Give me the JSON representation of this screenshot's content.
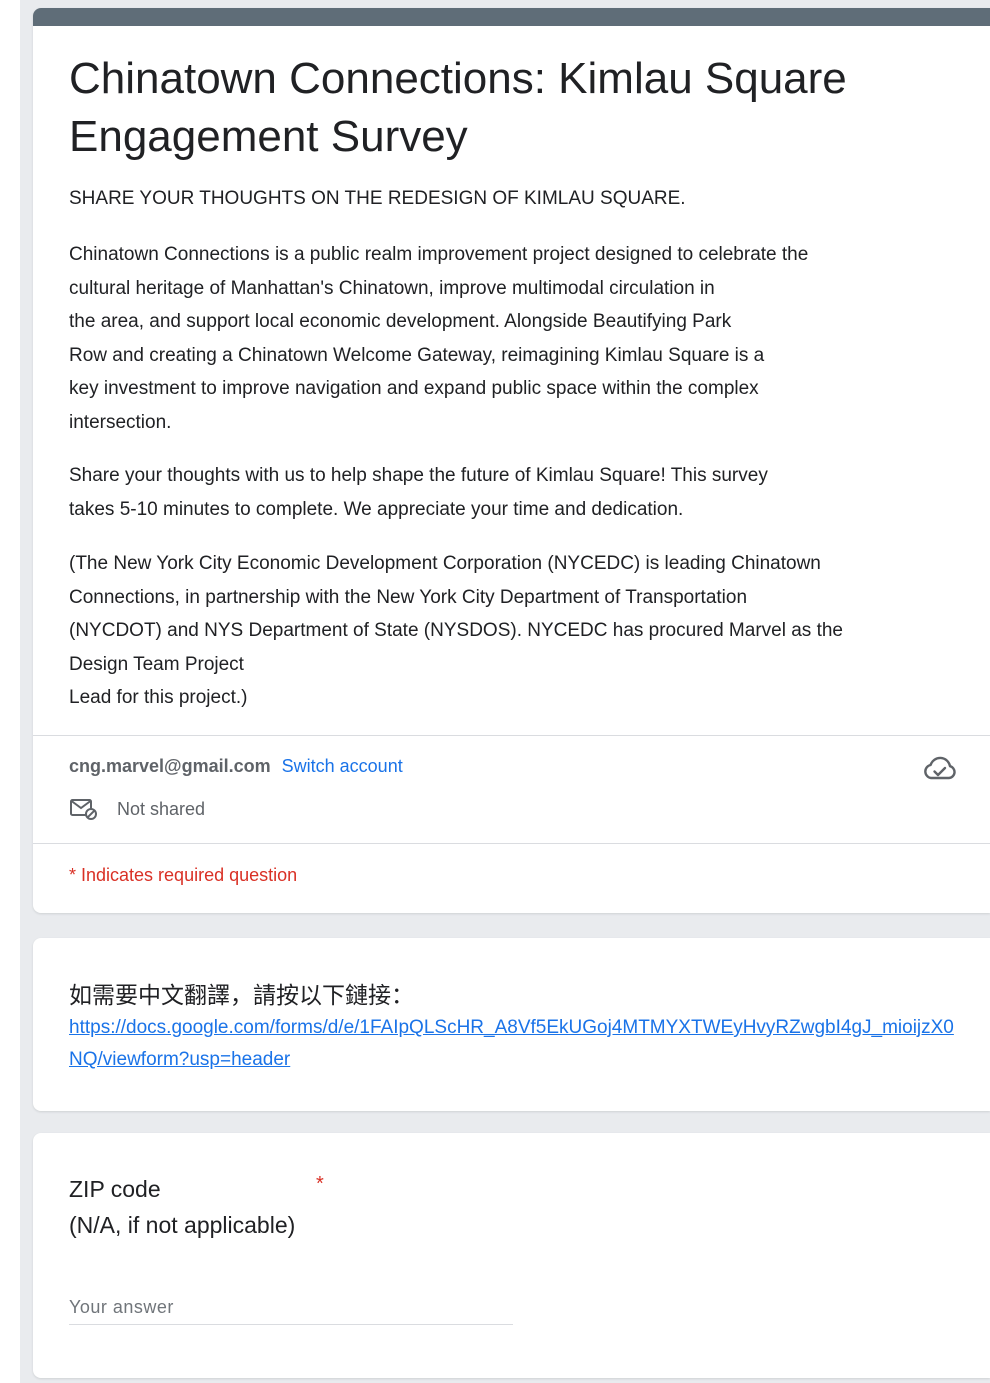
{
  "header": {
    "title": "Chinatown Connections: Kimlau Square Engagement Survey",
    "subtitle": "SHARE YOUR THOUGHTS ON THE REDESIGN OF KIMLAU SQUARE.",
    "description_paragraphs": [
      [
        "Chinatown Connections is a public realm improvement project designed to celebrate the",
        "cultural heritage of Manhattan's Chinatown, improve multimodal circulation in",
        "the area, and support local economic development. Alongside Beautifying Park",
        "Row and creating a Chinatown Welcome Gateway, reimagining Kimlau Square is a",
        "key investment to improve navigation and expand public space within the complex",
        "intersection."
      ],
      [
        "Share your thoughts with us to help shape the future of Kimlau Square! This survey",
        "takes 5-10 minutes to complete. We appreciate your time and dedication."
      ],
      [
        "(The New York City Economic Development Corporation (NYCEDC) is leading Chinatown",
        "Connections, in partnership with the New York City Department of Transportation",
        "(NYCDOT) and NYS Department of State (NYSDOS). NYCEDC has procured Marvel as the",
        "Design Team Project",
        "Lead for this project.)"
      ]
    ],
    "account": {
      "email": "cng.marvel@gmail.com",
      "switch_label": "Switch account",
      "shared_status": "Not shared",
      "cloud_icon": "cloud-saved-icon",
      "mail_icon": "email-not-shared-icon"
    },
    "required_note": "* Indicates required question"
  },
  "translation_section": {
    "text": "如需要中文翻譯，請按以下鏈接：",
    "link": "https://docs.google.com/forms/d/e/1FAIpQLScHR_A8Vf5EkUGoj4MTMYXTWEyHvyRZwgbI4gJ_mioijzX0NQ/viewform?usp=header"
  },
  "zip_question": {
    "label_line1": "ZIP code",
    "label_line2": "(N/A, if not applicable)",
    "required_mark": "*",
    "placeholder": "Your answer",
    "value": ""
  },
  "colors": {
    "header_bar": "#5f6d78",
    "link": "#1a73e8",
    "required": "#d93025",
    "page_background": "#e9ebee"
  }
}
